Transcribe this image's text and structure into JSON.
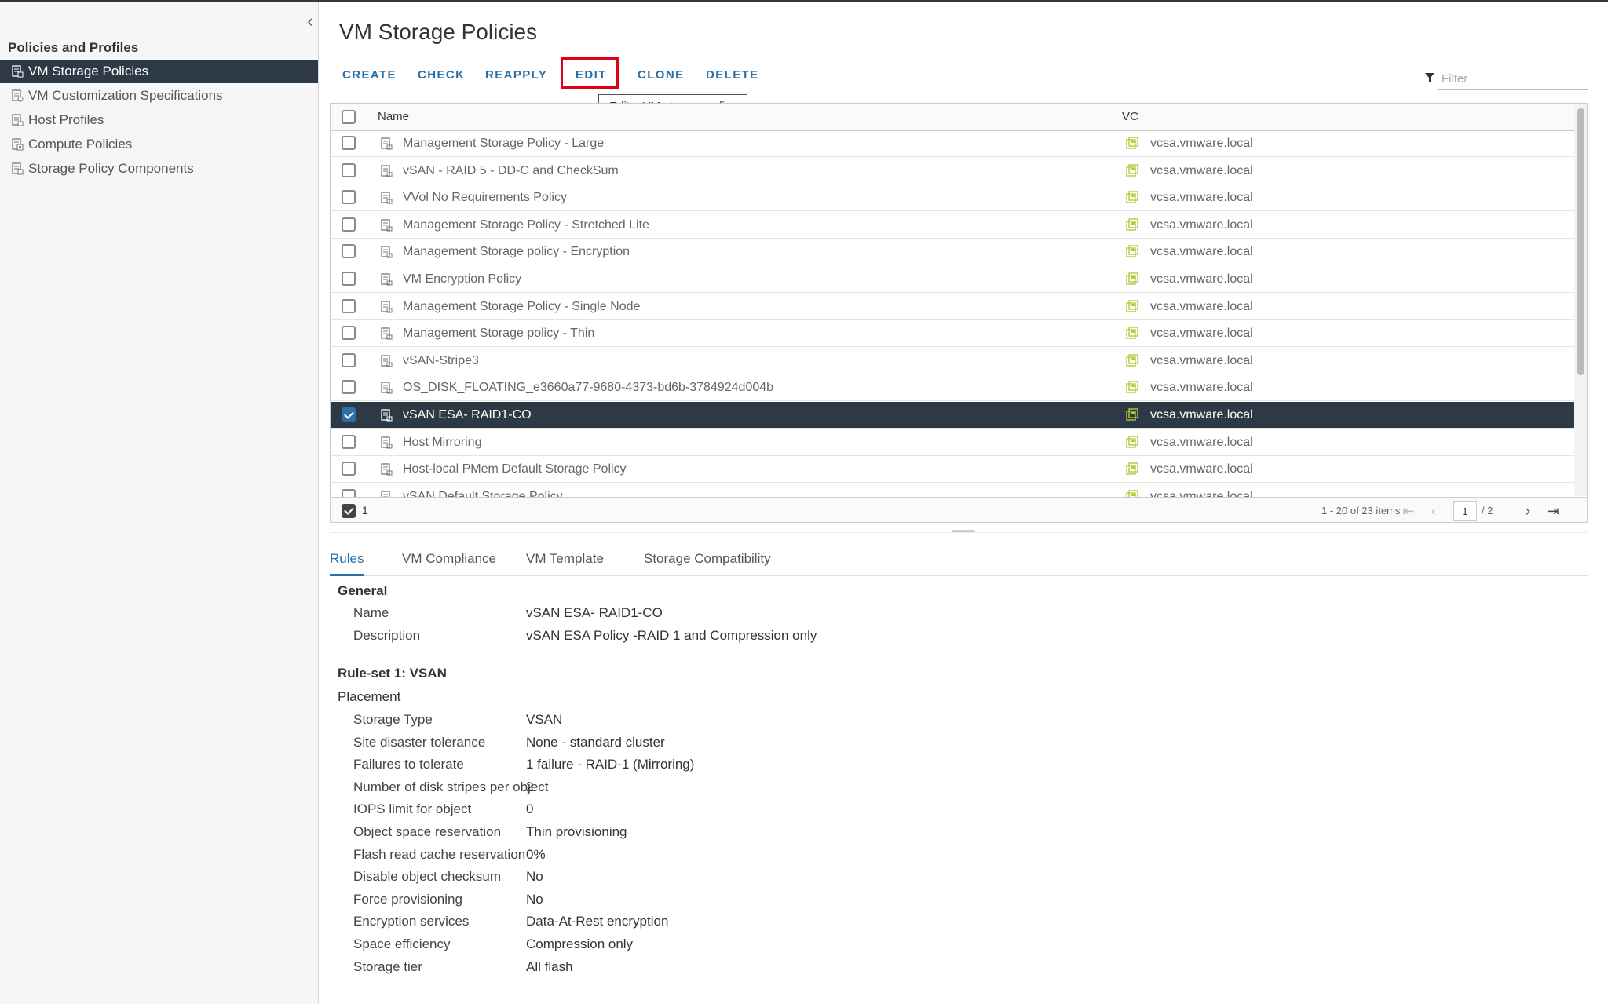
{
  "sidebar": {
    "title": "Policies and Profiles",
    "items": [
      {
        "label": "VM Storage Policies",
        "active": true
      },
      {
        "label": "VM Customization Specifications",
        "active": false
      },
      {
        "label": "Host Profiles",
        "active": false
      },
      {
        "label": "Compute Policies",
        "active": false
      },
      {
        "label": "Storage Policy Components",
        "active": false
      }
    ]
  },
  "main": {
    "title": "VM Storage Policies",
    "toolbar": {
      "create": "CREATE",
      "check": "CHECK",
      "reapply": "REAPPLY",
      "edit": "EDIT",
      "clone": "CLONE",
      "delete": "DELETE"
    },
    "tooltip": "Edit a VM storage policy",
    "filter_placeholder": "Filter",
    "grid": {
      "columns": {
        "name": "Name",
        "vc": "VC"
      },
      "rows": [
        {
          "name": "Management Storage Policy - Large",
          "vc": "vcsa.vmware.local",
          "selected": false
        },
        {
          "name": "vSAN - RAID 5 - DD-C and CheckSum",
          "vc": "vcsa.vmware.local",
          "selected": false
        },
        {
          "name": "VVol No Requirements Policy",
          "vc": "vcsa.vmware.local",
          "selected": false
        },
        {
          "name": "Management Storage Policy - Stretched Lite",
          "vc": "vcsa.vmware.local",
          "selected": false
        },
        {
          "name": "Management Storage policy - Encryption",
          "vc": "vcsa.vmware.local",
          "selected": false
        },
        {
          "name": "VM Encryption Policy",
          "vc": "vcsa.vmware.local",
          "selected": false
        },
        {
          "name": "Management Storage Policy - Single Node",
          "vc": "vcsa.vmware.local",
          "selected": false
        },
        {
          "name": "Management Storage policy - Thin",
          "vc": "vcsa.vmware.local",
          "selected": false
        },
        {
          "name": "vSAN-Stripe3",
          "vc": "vcsa.vmware.local",
          "selected": false
        },
        {
          "name": "OS_DISK_FLOATING_e3660a77-9680-4373-bd6b-3784924d004b",
          "vc": "vcsa.vmware.local",
          "selected": false
        },
        {
          "name": "vSAN ESA- RAID1-CO",
          "vc": "vcsa.vmware.local",
          "selected": true
        },
        {
          "name": "Host Mirroring",
          "vc": "vcsa.vmware.local",
          "selected": false
        },
        {
          "name": "Host-local PMem Default Storage Policy",
          "vc": "vcsa.vmware.local",
          "selected": false
        },
        {
          "name": "vSAN Default Storage Policy",
          "vc": "vcsa.vmware.local",
          "selected": false
        }
      ],
      "footer": {
        "selected_count": "1",
        "items_info": "1 - 20 of 23 items",
        "current_page": "1",
        "total_pages": "/ 2"
      }
    },
    "tabs": [
      "Rules",
      "VM Compliance",
      "VM Template",
      "Storage Compatibility"
    ],
    "details": {
      "general_title": "General",
      "general": [
        {
          "key": "Name",
          "value": "vSAN ESA- RAID1-CO"
        },
        {
          "key": "Description",
          "value": "vSAN ESA Policy -RAID 1 and Compression only"
        }
      ],
      "ruleset_title": "Rule-set 1: VSAN",
      "placement_title": "Placement",
      "placement": [
        {
          "key": "Storage Type",
          "value": "VSAN"
        },
        {
          "key": "Site disaster tolerance",
          "value": "None - standard cluster"
        },
        {
          "key": "Failures to tolerate",
          "value": "1 failure - RAID-1 (Mirroring)"
        },
        {
          "key": "Number of disk stripes per object",
          "value": "2"
        },
        {
          "key": "IOPS limit for object",
          "value": "0"
        },
        {
          "key": "Object space reservation",
          "value": "Thin provisioning"
        },
        {
          "key": "Flash read cache reservation",
          "value": "0%"
        },
        {
          "key": "Disable object checksum",
          "value": "No"
        },
        {
          "key": "Force provisioning",
          "value": "No"
        },
        {
          "key": "Encryption services",
          "value": "Data-At-Rest encryption"
        },
        {
          "key": "Space efficiency",
          "value": "Compression only"
        },
        {
          "key": "Storage tier",
          "value": "All flash"
        }
      ]
    }
  }
}
